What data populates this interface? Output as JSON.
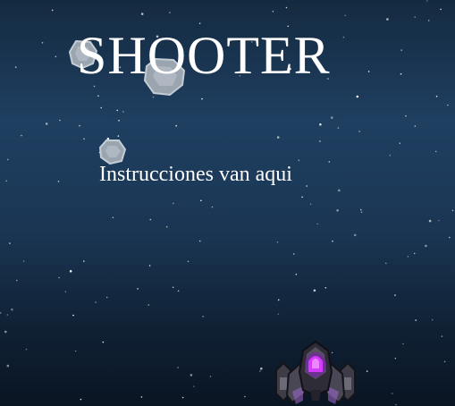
{
  "title": "SHOOTER",
  "instructions": "Instrucciones van aqui",
  "colors": {
    "background_top": "#142a40",
    "background_mid": "#1f3f61",
    "background_bottom": "#0a1523",
    "text": "#ffffff",
    "asteroid": "#aab4be",
    "ship_body": "#3a3a44",
    "ship_accent": "#c23cf0"
  },
  "sprites": {
    "player": "player-ship-icon",
    "asteroid": "asteroid-icon"
  }
}
